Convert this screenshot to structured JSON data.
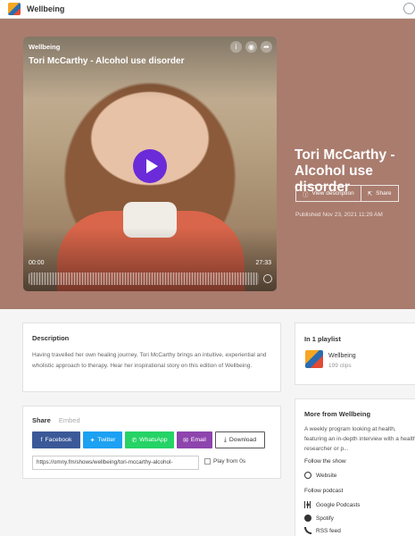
{
  "topbar": {
    "brand": "Wellbeing"
  },
  "player": {
    "show_name": "Wellbeing",
    "episode_title": "Tori McCarthy - Alcohol use disorder",
    "time_current": "00:00",
    "time_total": "27:33",
    "icons": [
      "info-icon",
      "subscribe-icon",
      "share-icon",
      "play-icon",
      "speed-icon"
    ]
  },
  "episode": {
    "title": "Tori McCarthy - Alcohol use disorder",
    "view_description_label": "View description",
    "share_label": "Share",
    "published": "Published Nov 23, 2021 11:29 AM"
  },
  "description": {
    "heading": "Description",
    "text": "Having travelled her own healing journey, Tori McCarthy brings an intuitive, experiential and wholistic approach to therapy. Hear her inspirational story on this edition of Wellbeing."
  },
  "share_section": {
    "tab_share": "Share",
    "tab_embed": "Embed",
    "buttons": [
      {
        "label": "Facebook",
        "color": "#3b5998",
        "icon": "facebook-icon"
      },
      {
        "label": "Twitter",
        "color": "#1da1f2",
        "icon": "twitter-icon"
      },
      {
        "label": "WhatsApp",
        "color": "#25d366",
        "icon": "whatsapp-icon"
      },
      {
        "label": "Email",
        "color": "#8e44ad",
        "icon": "email-icon"
      },
      {
        "label": "Download",
        "color": "#ffffff",
        "icon": "download-icon"
      }
    ],
    "url": "https://omny.fm/shows/wellbeing/tori-mccarthy-alcohol-",
    "play_from_label": "Play from 0s"
  },
  "playlist": {
    "heading": "In 1 playlist",
    "name": "Wellbeing",
    "clips": "199 clips"
  },
  "more": {
    "heading": "More from Wellbeing",
    "text": "A weekly program looking at health, featuring an in-depth interview with a health researcher or p...",
    "follow_show": "Follow the show",
    "website": "Website",
    "follow_podcast": "Follow podcast",
    "google_podcasts": "Google Podcasts",
    "spotify": "Spotify",
    "rss": "RSS feed"
  }
}
